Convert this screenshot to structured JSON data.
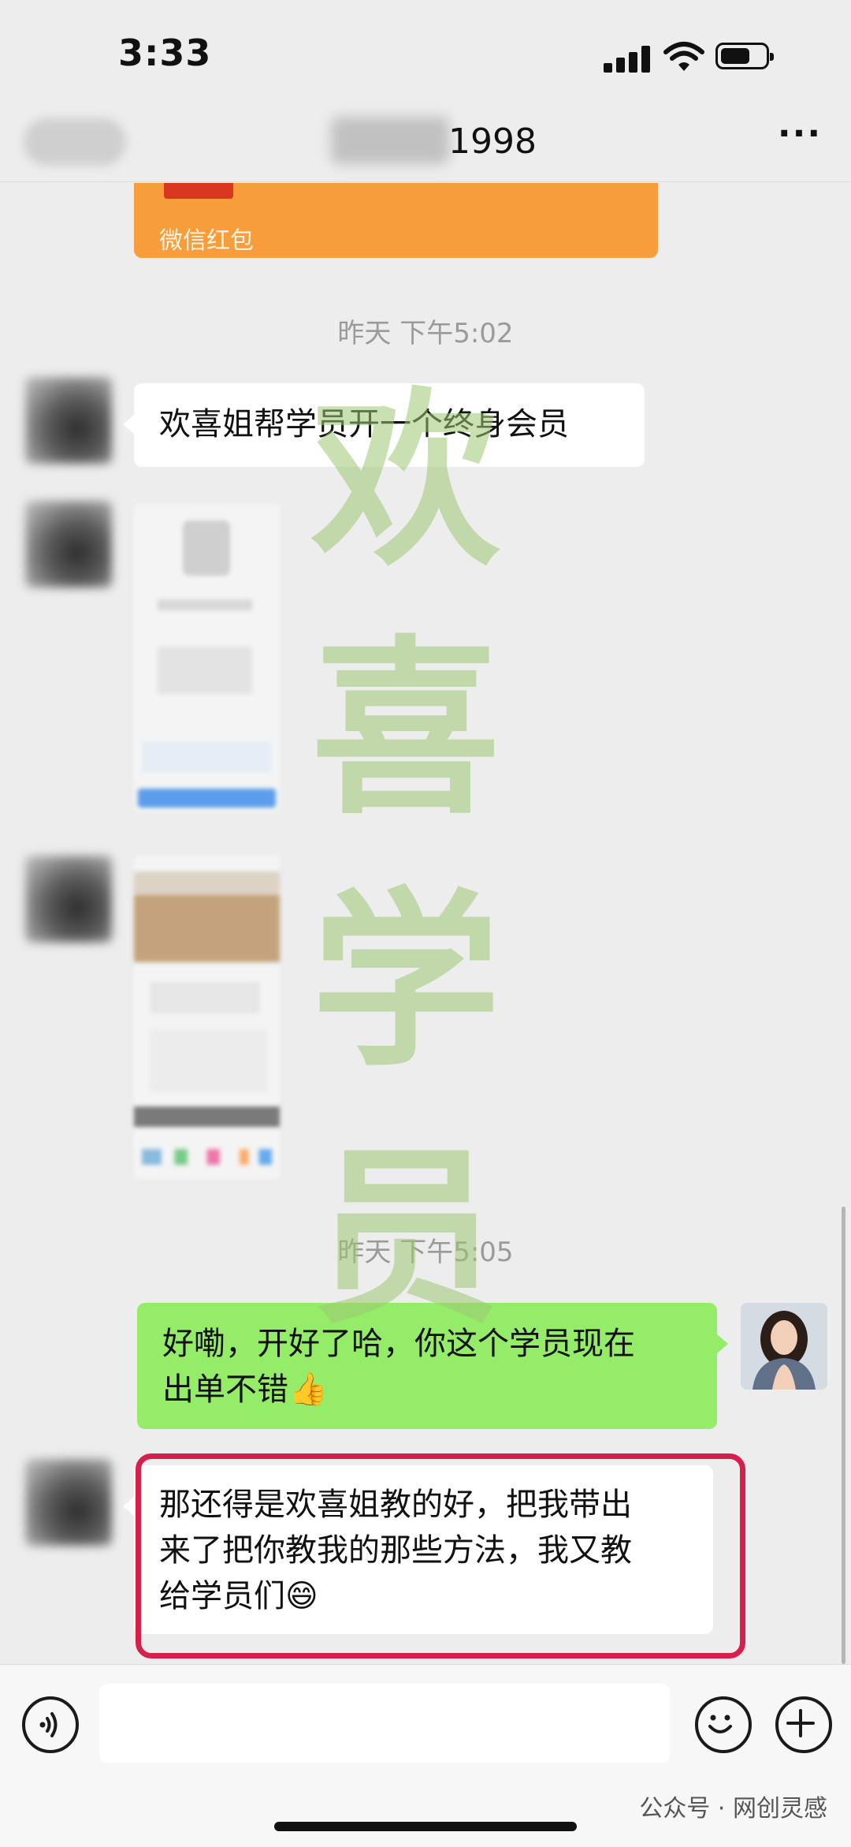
{
  "status_bar": {
    "time": "3:33"
  },
  "nav": {
    "title_suffix": "1998",
    "more": "···"
  },
  "messages": [
    {
      "type": "red_packet",
      "label": "微信红包"
    },
    {
      "type": "timestamp",
      "text": "昨天 下午5:02"
    },
    {
      "type": "text",
      "direction": "in",
      "text": "欢喜姐帮学员开一个终身会员"
    },
    {
      "type": "image",
      "direction": "in"
    },
    {
      "type": "image",
      "direction": "in"
    },
    {
      "type": "timestamp",
      "text": "昨天 下午5:05"
    },
    {
      "type": "text",
      "direction": "out",
      "lines": [
        "好嘞，开好了哈，你这个学员现在",
        "出单不错👍"
      ]
    },
    {
      "type": "text",
      "direction": "in",
      "highlighted": true,
      "lines": [
        "那还得是欢喜姐教的好，把我带出",
        "来了把你教我的那些方法，我又教",
        "给学员们😄"
      ]
    }
  ],
  "watermark": [
    "欢",
    "喜",
    "学",
    "员"
  ],
  "input_bar": {
    "voice_icon": "voice-icon",
    "emoji_icon": "emoji-icon",
    "plus_icon": "plus-icon"
  },
  "footnote": "公众号 · 网创灵感",
  "colors": {
    "bubble_out": "#95ec69",
    "bubble_in": "#ffffff",
    "red_packet": "#f79d3c",
    "highlight": "#d61f4a",
    "watermark": "#9cc872"
  }
}
